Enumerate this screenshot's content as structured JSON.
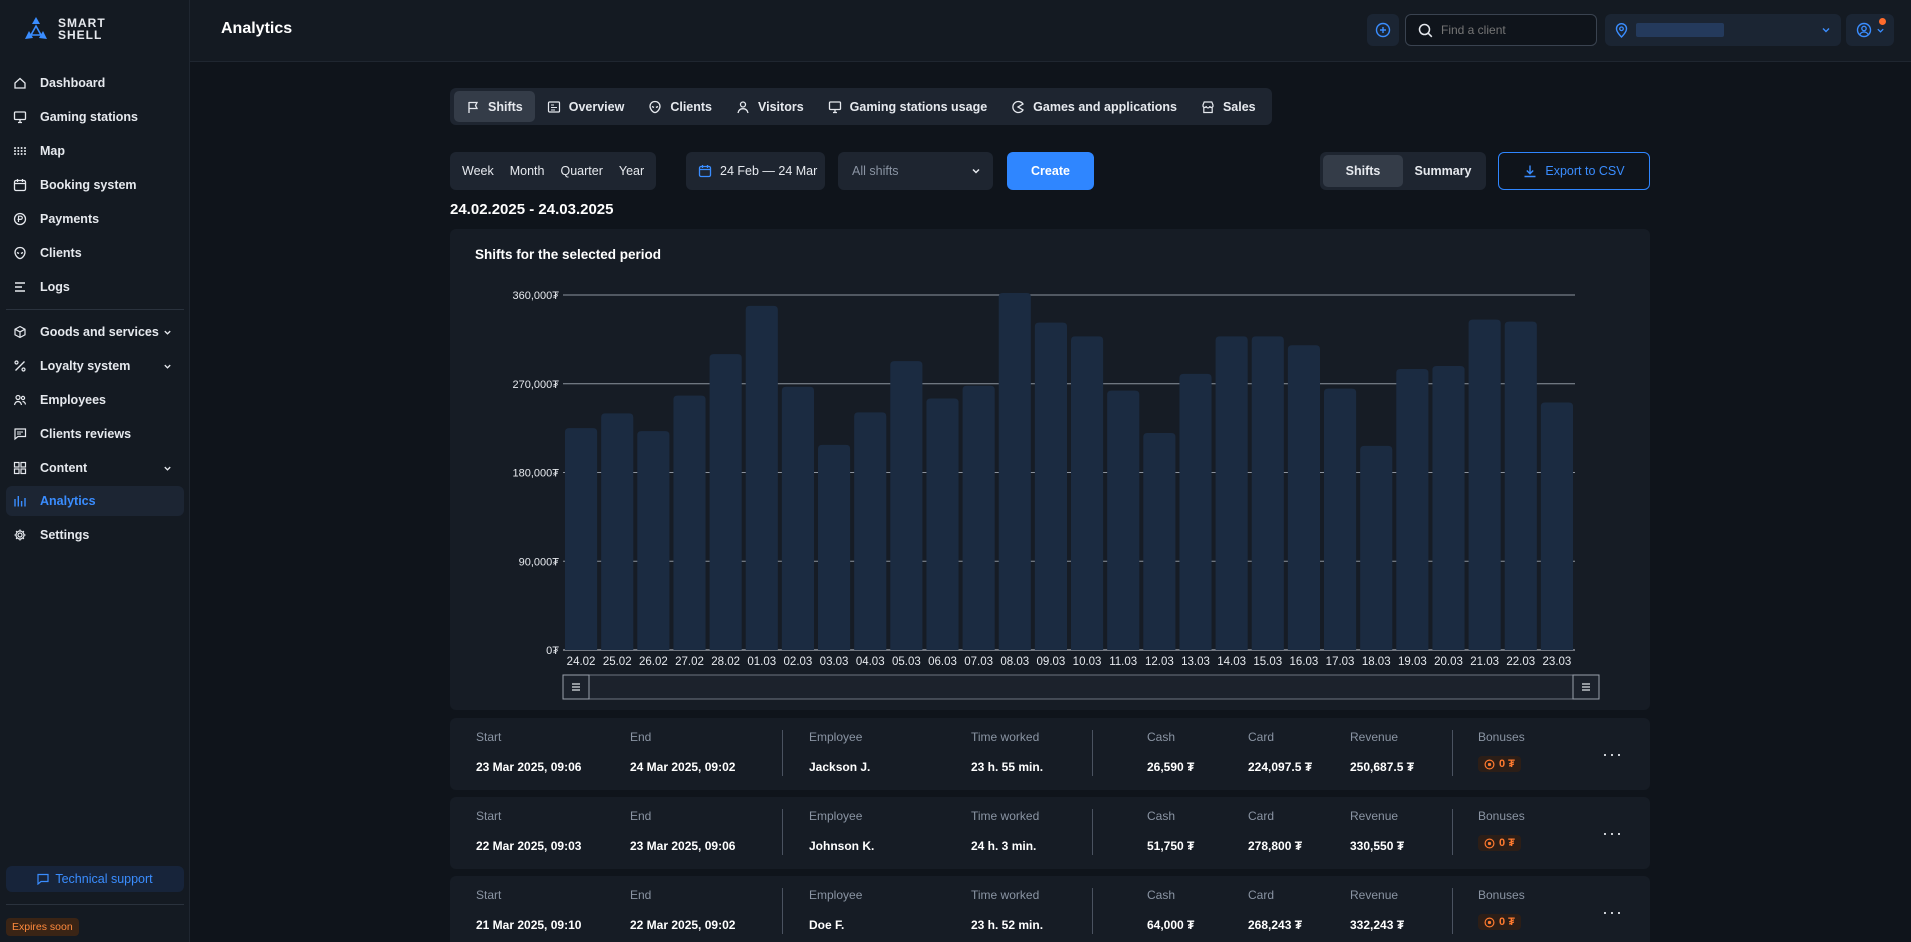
{
  "app": {
    "logo_text_line1": "SMART",
    "logo_text_line2": "SHELL",
    "page_title": "Analytics"
  },
  "sidebar": {
    "items": [
      {
        "label": "Dashboard",
        "icon": "home-icon"
      },
      {
        "label": "Gaming stations",
        "icon": "monitor-icon"
      },
      {
        "label": "Map",
        "icon": "grid-dots-icon"
      },
      {
        "label": "Booking system",
        "icon": "calendar-icon"
      },
      {
        "label": "Payments",
        "icon": "coin-icon"
      },
      {
        "label": "Clients",
        "icon": "alien-icon"
      },
      {
        "label": "Logs",
        "icon": "lines-icon"
      },
      {
        "label": "Goods and services",
        "icon": "box-icon",
        "expandable": true
      },
      {
        "label": "Loyalty system",
        "icon": "percent-icon",
        "expandable": true
      },
      {
        "label": "Employees",
        "icon": "users-icon"
      },
      {
        "label": "Clients reviews",
        "icon": "chat-icon"
      },
      {
        "label": "Content",
        "icon": "tiles-icon",
        "expandable": true
      },
      {
        "label": "Analytics",
        "icon": "chart-icon",
        "active": true
      },
      {
        "label": "Settings",
        "icon": "gear-icon"
      }
    ],
    "support_label": "Technical support",
    "expires_label": "Expires soon"
  },
  "topbar": {
    "search_placeholder": "Find a client"
  },
  "tabs": [
    {
      "label": "Shifts",
      "icon": "flag-icon",
      "active": true
    },
    {
      "label": "Overview",
      "icon": "overview-icon"
    },
    {
      "label": "Clients",
      "icon": "alien-icon"
    },
    {
      "label": "Visitors",
      "icon": "user-icon"
    },
    {
      "label": "Gaming stations usage",
      "icon": "monitor-icon"
    },
    {
      "label": "Games and applications",
      "icon": "pacman-icon"
    },
    {
      "label": "Sales",
      "icon": "store-icon"
    }
  ],
  "filters": {
    "periods": [
      "Week",
      "Month",
      "Quarter",
      "Year"
    ],
    "date_range": "24 Feb — 24 Mar",
    "shift_select": "All shifts",
    "create_label": "Create",
    "view": [
      "Shifts",
      "Summary"
    ],
    "export_label": "Export to CSV"
  },
  "range_title": "24.02.2025 - 24.03.2025",
  "chart_data": {
    "type": "bar",
    "title": "Shifts for the selected period",
    "categories": [
      "24.02",
      "25.02",
      "26.02",
      "27.02",
      "28.02",
      "01.03",
      "02.03",
      "03.03",
      "04.03",
      "05.03",
      "06.03",
      "07.03",
      "08.03",
      "09.03",
      "10.03",
      "11.03",
      "12.03",
      "13.03",
      "14.03",
      "15.03",
      "16.03",
      "17.03",
      "18.03",
      "19.03",
      "20.03",
      "21.03",
      "22.03",
      "23.03"
    ],
    "values": [
      225000,
      240000,
      222000,
      258000,
      300000,
      349000,
      267000,
      208000,
      241000,
      293000,
      255000,
      268000,
      362000,
      332000,
      318000,
      263000,
      220000,
      280000,
      318000,
      318000,
      309000,
      265000,
      207000,
      285000,
      288000,
      335000,
      333000,
      251000
    ],
    "ylim": [
      0,
      360000
    ],
    "y_ticks": [
      "0₮",
      "90,000₮",
      "180,000₮",
      "270,000₮",
      "360,000₮"
    ],
    "grid": true,
    "bar_color": "#1b2b41"
  },
  "table_labels": {
    "start": "Start",
    "end": "End",
    "employee": "Employee",
    "time_worked": "Time worked",
    "cash": "Cash",
    "card": "Card",
    "revenue": "Revenue",
    "bonuses": "Bonuses"
  },
  "shifts": [
    {
      "start": "23 Mar 2025, 09:06",
      "end": "24 Mar 2025, 09:02",
      "employee": "Jackson J.",
      "time_worked": "23 h. 55 min.",
      "cash": "26,590 ₮",
      "card": "224,097.5 ₮",
      "revenue": "250,687.5 ₮",
      "bonuses": "0 ₮"
    },
    {
      "start": "22 Mar 2025, 09:03",
      "end": "23 Mar 2025, 09:06",
      "employee": "Johnson K.",
      "time_worked": "24 h. 3 min.",
      "cash": "51,750 ₮",
      "card": "278,800 ₮",
      "revenue": "330,550 ₮",
      "bonuses": "0 ₮"
    },
    {
      "start": "21 Mar 2025, 09:10",
      "end": "22 Mar 2025, 09:02",
      "employee": "Doe F.",
      "time_worked": "23 h. 52 min.",
      "cash": "64,000 ₮",
      "card": "268,243 ₮",
      "revenue": "332,243 ₮",
      "bonuses": "0 ₮"
    }
  ],
  "colors": {
    "accent": "#2f86ff",
    "bonus": "#ff7a2f",
    "background": "#0f141b",
    "panel": "#161c25"
  }
}
